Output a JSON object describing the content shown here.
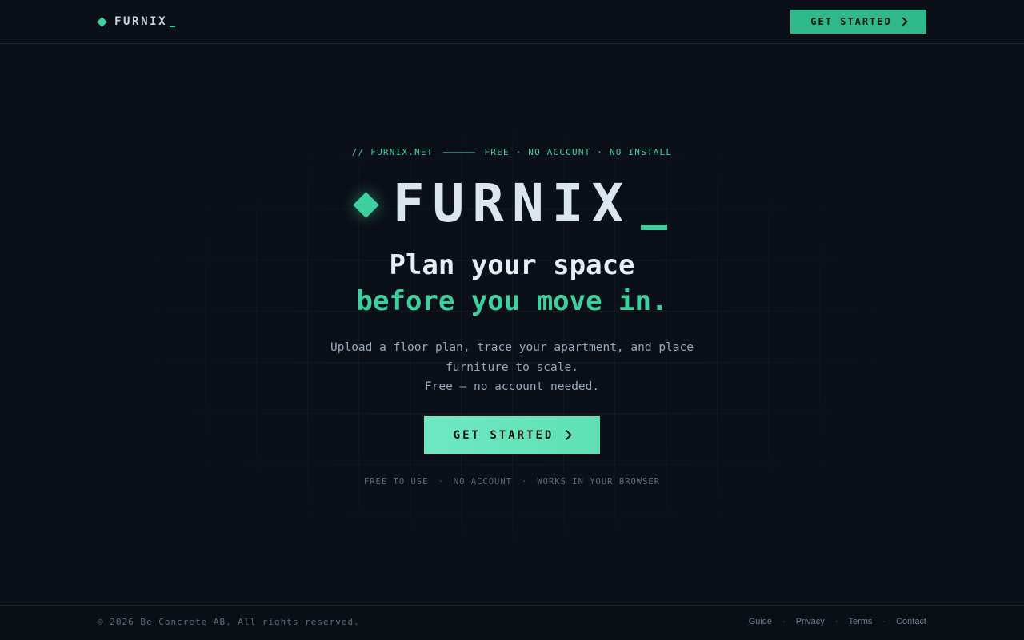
{
  "nav": {
    "brand": "FURNIX",
    "cta_label": "GET STARTED"
  },
  "hero": {
    "eyebrow_left": "// FURNIX.NET",
    "eyebrow_right": "FREE · NO ACCOUNT · NO INSTALL",
    "logo_text": "FURNIX",
    "headline_line1": "Plan your space",
    "headline_line2": "before you move in.",
    "description_line1": "Upload a floor plan, trace your apartment, and place",
    "description_line2": "furniture to scale.",
    "description_line3": "Free — no account needed.",
    "cta_label": "GET STARTED",
    "features": [
      "FREE TO USE",
      "NO ACCOUNT",
      "WORKS IN YOUR BROWSER"
    ],
    "feature_separator": "·"
  },
  "footer": {
    "copyright": "© 2026 Be Concrete AB. All rights reserved.",
    "links": [
      "Guide",
      "Privacy",
      "Terms",
      "Contact"
    ],
    "separator": "·"
  },
  "colors": {
    "background": "#0b0f17",
    "accent": "#3ecf9e",
    "button_nav": "#2fb889",
    "button_hero": "#6fe8c4"
  }
}
